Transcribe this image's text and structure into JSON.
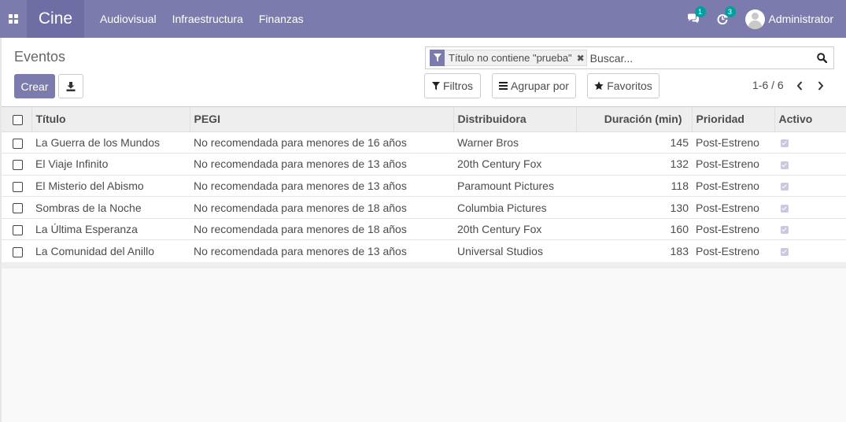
{
  "navbar": {
    "brand": "Cine",
    "menu": [
      "Audiovisual",
      "Infraestructura",
      "Finanzas"
    ],
    "messages_count": "1",
    "activities_count": "3",
    "user_name": "Administrator"
  },
  "control_panel": {
    "breadcrumb": "Eventos",
    "create_label": "Crear",
    "facet_text": "Título no contiene \"prueba\"",
    "facet_remove": "✖",
    "search_placeholder": "Buscar...",
    "filters_label": "Filtros",
    "group_by_label": "Agrupar por",
    "favorites_label": "Favoritos",
    "pager": "1-6 / 6"
  },
  "table": {
    "columns": [
      "Título",
      "PEGI",
      "Distribuidora",
      "Duración (min)",
      "Prioridad",
      "Activo"
    ],
    "rows": [
      {
        "titulo": "La Guerra de los Mundos",
        "pegi": "No recomendada para menores de 16 años",
        "distribuidora": "Warner Bros",
        "duracion": "145",
        "prioridad": "Post-Estreno",
        "activo": true
      },
      {
        "titulo": "El Viaje Infinito",
        "pegi": "No recomendada para menores de 13 años",
        "distribuidora": "20th Century Fox",
        "duracion": "132",
        "prioridad": "Post-Estreno",
        "activo": true
      },
      {
        "titulo": "El Misterio del Abismo",
        "pegi": "No recomendada para menores de 13 años",
        "distribuidora": "Paramount Pictures",
        "duracion": "118",
        "prioridad": "Post-Estreno",
        "activo": true
      },
      {
        "titulo": "Sombras de la Noche",
        "pegi": "No recomendada para menores de 18 años",
        "distribuidora": "Columbia Pictures",
        "duracion": "130",
        "prioridad": "Post-Estreno",
        "activo": true
      },
      {
        "titulo": "La Última Esperanza",
        "pegi": "No recomendada para menores de 18 años",
        "distribuidora": "20th Century Fox",
        "duracion": "160",
        "prioridad": "Post-Estreno",
        "activo": true
      },
      {
        "titulo": "La Comunidad del Anillo",
        "pegi": "No recomendada para menores de 13 años",
        "distribuidora": "Universal Studios",
        "duracion": "183",
        "prioridad": "Post-Estreno",
        "activo": true
      }
    ]
  },
  "icons": {
    "apps": "apps-grid-icon",
    "messages": "chat-bubbles-icon",
    "activities": "clock-refresh-icon",
    "download": "download-icon",
    "facet": "filter-funnel-icon",
    "search": "magnifier-icon",
    "filters": "filter-funnel-icon",
    "group_by": "list-bars-icon",
    "favorites": "star-icon",
    "prev": "chevron-left-icon",
    "next": "chevron-right-icon"
  },
  "colors": {
    "brand": "#7c7bad",
    "brand_dark": "#6e6da4",
    "badge": "#00a09d"
  }
}
